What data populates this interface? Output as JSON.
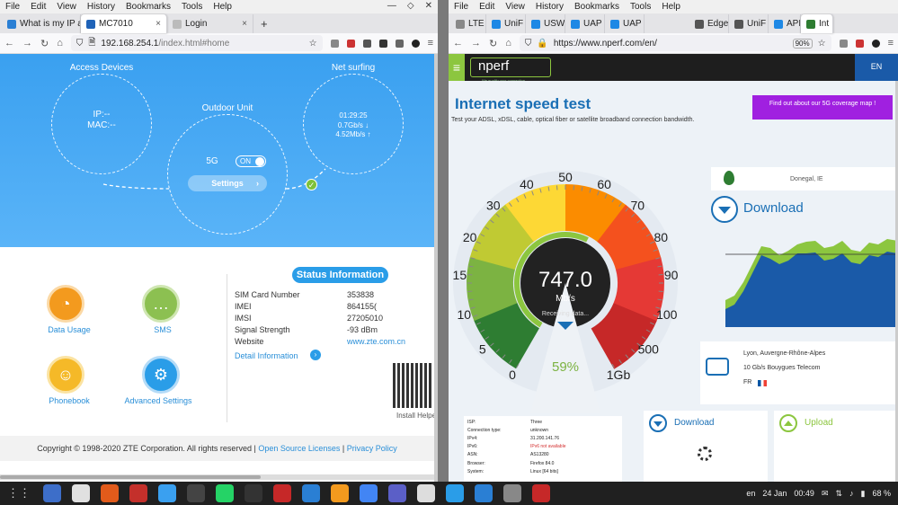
{
  "left": {
    "menu": [
      "File",
      "Edit",
      "View",
      "History",
      "Bookmarks",
      "Tools",
      "Help"
    ],
    "tabs": [
      {
        "label": "What is my IP addr",
        "close": "×"
      },
      {
        "label": "MC7010",
        "close": "×"
      },
      {
        "label": "Login",
        "close": "×"
      }
    ],
    "new_tab": "+",
    "url_host": "192.168.254.1",
    "url_path": "/index.html#home",
    "zte": {
      "access_devices": "Access Devices",
      "ip": "IP:--",
      "mac": "MAC:--",
      "outdoor_unit": "Outdoor Unit",
      "fiveg": "5G",
      "toggle": "ON",
      "settings": "Settings",
      "net_surfing": "Net surfing",
      "time": "01:29:25",
      "down": "0.7Gb/s ↓",
      "up": "4.52Mb/s ↑",
      "icons": [
        {
          "label": "Data Usage",
          "color": "#f39a1e"
        },
        {
          "label": "SMS",
          "color": "#8cc051"
        },
        {
          "label": "Phonebook",
          "color": "#f5b928"
        },
        {
          "label": "Advanced Settings",
          "color": "#2a9de8"
        }
      ],
      "status_title": "Status Information",
      "rows": [
        {
          "k": "SIM Card Number",
          "v": "353838"
        },
        {
          "k": "IMEI",
          "v": "864155("
        },
        {
          "k": "IMSI",
          "v": "27205010"
        },
        {
          "k": "Signal Strength",
          "v": "-93 dBm"
        },
        {
          "k": "Website",
          "v": "www.zte.com.cn"
        }
      ],
      "detail": "Detail Information",
      "qr_label": "Install Helpe",
      "copyright": "Copyright © 1998-2020 ZTE Corporation. All rights reserved",
      "sep": "|",
      "open_source": "Open Source Licenses",
      "privacy": "Privacy Policy"
    }
  },
  "right": {
    "menu": [
      "File",
      "Edit",
      "View",
      "History",
      "Bookmarks",
      "Tools",
      "Help"
    ],
    "tabs": [
      {
        "label": "LTE",
        "color": "#1e88e5"
      },
      {
        "label": "UniF",
        "color": "#1e88e5"
      },
      {
        "label": "USW",
        "color": "#1e88e5"
      },
      {
        "label": "UAP",
        "color": "#1e88e5"
      },
      {
        "label": "UAP",
        "color": "#1e88e5"
      },
      {
        "label": "Edge",
        "color": "#555"
      },
      {
        "label": "UniF",
        "color": "#555"
      },
      {
        "label": "APN",
        "color": "#1e88e5"
      },
      {
        "label": "Int",
        "color": "#2e7d32"
      }
    ],
    "url": "https://www.nperf.com/en/",
    "zoom": "90%",
    "nperf": {
      "logo": "nperf",
      "logo_sub": "We qualify your connection",
      "lang": "EN",
      "title": "Internet speed test",
      "subtitle": "Test your ADSL, xDSL, cable, optical fiber or satellite broadband connection bandwidth.",
      "coverage": "Find out about our 5G coverage map !",
      "location": "Donegal, IE",
      "download": "Download",
      "speed": "747.0",
      "unit": "Mb/s",
      "receiving": "Receiving data...",
      "progress": "59%",
      "progress_value": 59,
      "ticks": [
        "0",
        "5",
        "10",
        "15",
        "20",
        "30",
        "40",
        "50",
        "60",
        "70",
        "80",
        "90",
        "100",
        "500",
        "1Gb"
      ],
      "server_city": "Lyon, Auvergne-Rhône-Alpes",
      "server_isp": "10 Gb/s Bouygues Telecom",
      "server_cc": "FR",
      "info": [
        {
          "k": "ISP:",
          "v": "Three"
        },
        {
          "k": "Connection type:",
          "v": "unknown"
        },
        {
          "k": "IPv4:",
          "v": "31.200.141.76"
        },
        {
          "k": "IPv6:",
          "v": "IPv6 not available"
        },
        {
          "k": "ASN:",
          "v": "AS13280"
        },
        {
          "k": "Browser:",
          "v": "Firefox 84.0"
        },
        {
          "k": "System:",
          "v": "Linux [64 bits]"
        }
      ],
      "dl_label": "Download",
      "ul_label": "Upload"
    }
  },
  "taskbar": {
    "lang": "en",
    "date": "24 Jan",
    "time": "00:49",
    "battery": "68 %",
    "apps": [
      "#3d6ec9",
      "#e0e0e0",
      "#e25b1b",
      "#c4302b",
      "#3aa0f0",
      "#444",
      "#25d366",
      "#333",
      "#c62828",
      "#2a7fd4",
      "#f39a1e",
      "#4285f4",
      "#5b5fc7",
      "#ddd",
      "#2a9de8",
      "#2a7fd4",
      "#888",
      "#c62828"
    ]
  }
}
